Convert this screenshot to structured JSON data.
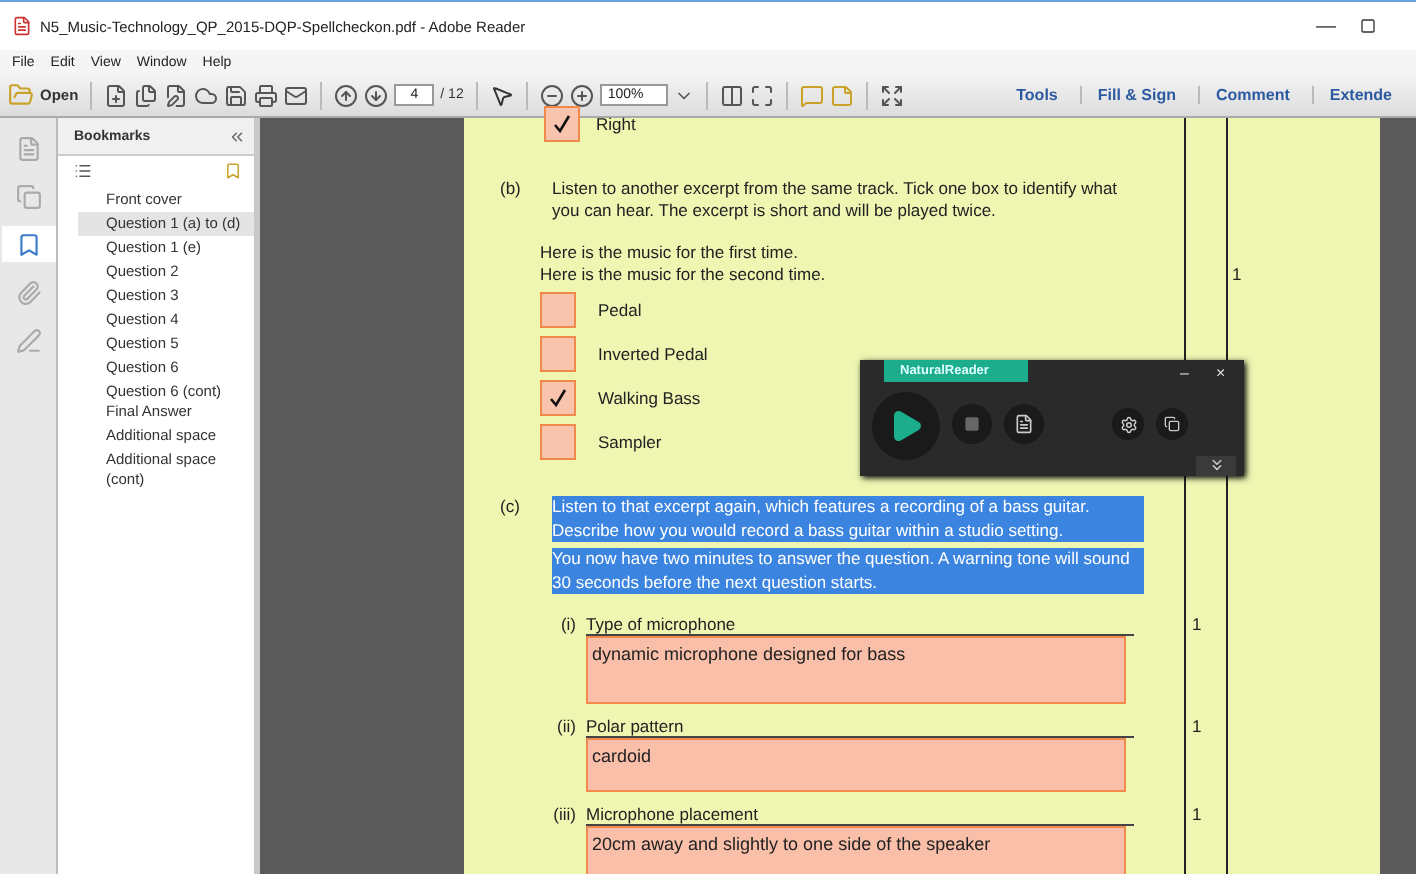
{
  "window": {
    "title": "N5_Music-Technology_QP_2015-DQP-Spellcheckon.pdf - Adobe Reader",
    "minimize": "—"
  },
  "menu": [
    "File",
    "Edit",
    "View",
    "Window",
    "Help"
  ],
  "toolbar": {
    "open_label": "Open",
    "page": "4",
    "page_total": "/ 12",
    "zoom": "100%",
    "panes": [
      {
        "label": "Tools"
      },
      {
        "label": "Fill & Sign"
      },
      {
        "label": "Comment"
      },
      {
        "label": "Extende"
      }
    ]
  },
  "side_tabs": [
    {
      "selected": false
    },
    {
      "selected": false
    },
    {
      "selected": true
    },
    {
      "selected": false
    },
    {
      "selected": false
    }
  ],
  "bookmarks": {
    "title": "Bookmarks",
    "items": [
      {
        "label": "Front cover",
        "selected": false
      },
      {
        "label": "Question 1 (a) to (d)",
        "selected": true
      },
      {
        "label": "Question 1 (e)",
        "selected": false
      },
      {
        "label": "Question 2",
        "selected": false
      },
      {
        "label": "Question 3",
        "selected": false
      },
      {
        "label": "Question 4",
        "selected": false
      },
      {
        "label": "Question 5",
        "selected": false
      },
      {
        "label": "Question 6",
        "selected": false
      },
      {
        "label": "Question 6 (cont) Final Answer",
        "selected": false
      },
      {
        "label": "Additional space",
        "selected": false
      },
      {
        "label": "Additional space (cont)",
        "selected": false
      }
    ]
  },
  "document": {
    "previous_option": {
      "label": "Right",
      "checked": true
    },
    "part_b": {
      "marker": "(b)",
      "prompt": "Listen to another excerpt from the same track.  Tick one box to identify what you can hear.  The excerpt is short and will be played twice.",
      "lines": [
        "Here is the music for the first time.",
        "Here is the music for the second time."
      ],
      "marks": "1",
      "options": [
        {
          "label": "Pedal",
          "checked": false
        },
        {
          "label": "Inverted Pedal",
          "checked": false
        },
        {
          "label": "Walking Bass",
          "checked": true
        },
        {
          "label": "Sampler",
          "checked": false
        }
      ]
    },
    "part_c": {
      "marker": "(c)",
      "paragraphs": [
        {
          "text": "Listen to that excerpt again, which features a recording of a bass guitar. Describe how you would record a bass guitar within a studio setting.",
          "highlighted": true
        },
        {
          "text": "You now have two minutes to answer the question.  A warning tone will sound 30 seconds before the next question starts.",
          "highlighted": true
        }
      ],
      "questions": [
        {
          "number": "(i)",
          "label": "Type of microphone",
          "marks": "1",
          "answer": "dynamic microphone designed for bass"
        },
        {
          "number": "(ii)",
          "label": "Polar pattern",
          "marks": "1",
          "answer": "cardoid"
        },
        {
          "number": "(iii)",
          "label": "Microphone placement",
          "marks": "1",
          "answer": "20cm away and slightly to one side of the speaker"
        }
      ]
    }
  },
  "reader": {
    "title": "NaturalReader",
    "minimize": "–",
    "close": "×"
  }
}
